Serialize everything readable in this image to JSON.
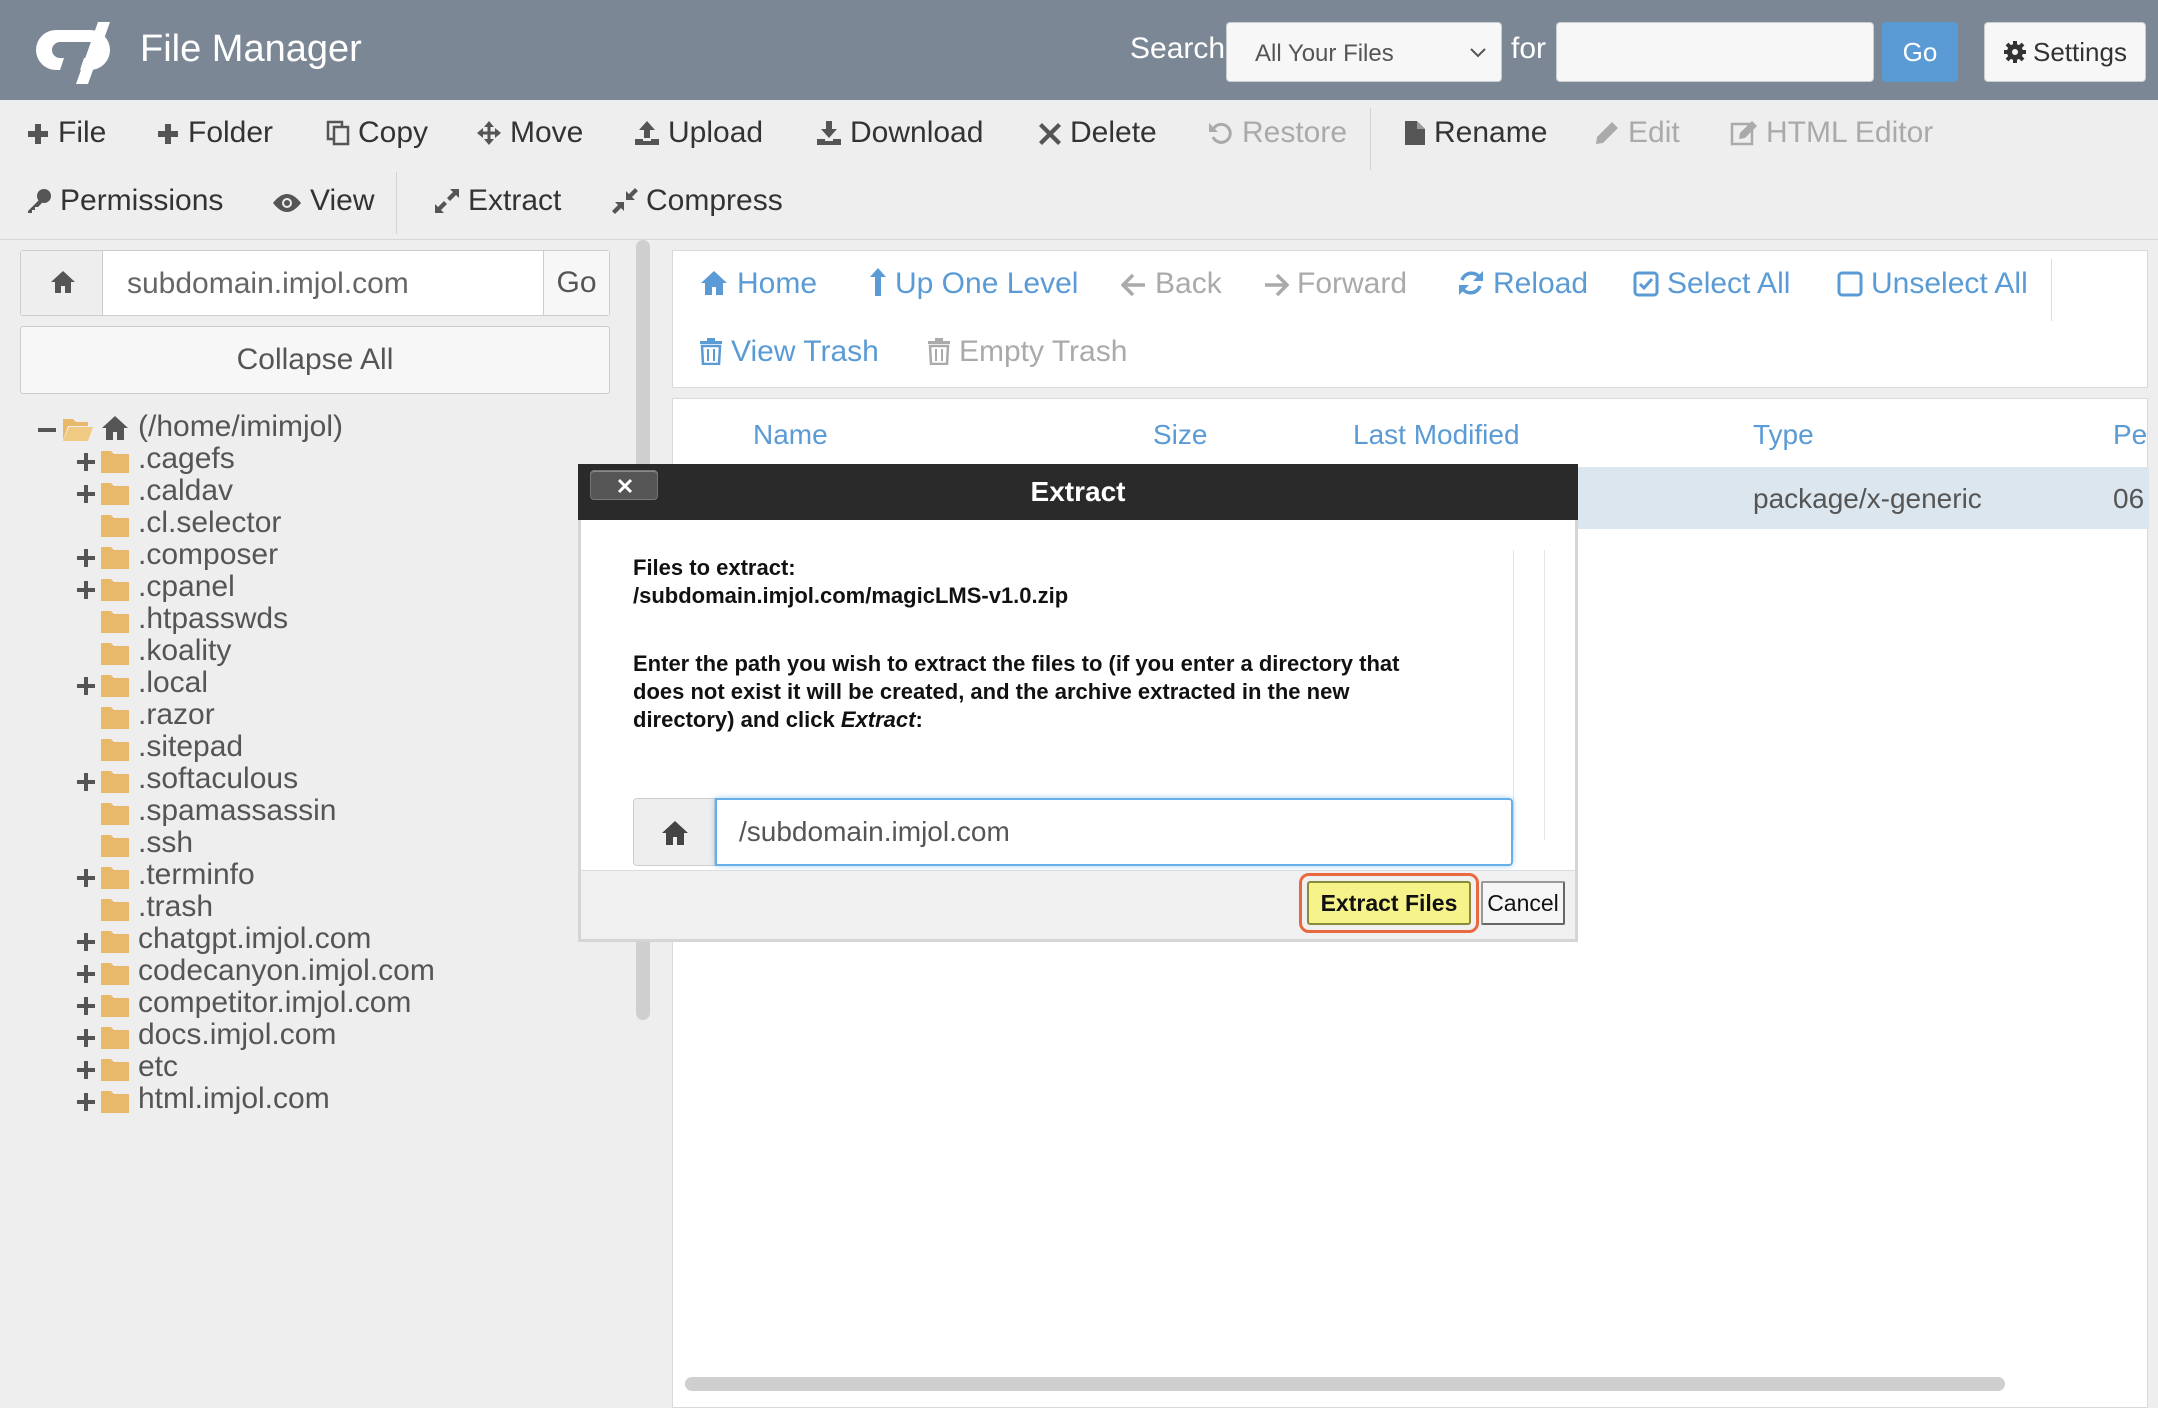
{
  "header": {
    "app_title": "File Manager",
    "search_label": "Search",
    "search_scope": "All Your Files",
    "for_label": "for",
    "search_value": "",
    "go_label": "Go",
    "settings_label": "Settings"
  },
  "toolbar": {
    "row1": [
      "File",
      "Folder",
      "Copy",
      "Move",
      "Upload",
      "Download",
      "Delete",
      "Restore",
      "Rename",
      "Edit",
      "HTML Editor"
    ],
    "row2": [
      "Permissions",
      "View",
      "Extract",
      "Compress"
    ]
  },
  "left": {
    "path_value": "subdomain.imjol.com",
    "go_label": "Go",
    "collapse_label": "Collapse All",
    "root": "(/home/imimjol)",
    "tree": [
      {
        "label": ".cagefs",
        "expandable": true
      },
      {
        "label": ".caldav",
        "expandable": true
      },
      {
        "label": ".cl.selector",
        "expandable": false
      },
      {
        "label": ".composer",
        "expandable": true
      },
      {
        "label": ".cpanel",
        "expandable": true
      },
      {
        "label": ".htpasswds",
        "expandable": false
      },
      {
        "label": ".koality",
        "expandable": false
      },
      {
        "label": ".local",
        "expandable": true
      },
      {
        "label": ".razor",
        "expandable": false
      },
      {
        "label": ".sitepad",
        "expandable": false
      },
      {
        "label": ".softaculous",
        "expandable": true
      },
      {
        "label": ".spamassassin",
        "expandable": false
      },
      {
        "label": ".ssh",
        "expandable": false
      },
      {
        "label": ".terminfo",
        "expandable": true
      },
      {
        "label": ".trash",
        "expandable": false
      },
      {
        "label": "chatgpt.imjol.com",
        "expandable": true
      },
      {
        "label": "codecanyon.imjol.com",
        "expandable": true
      },
      {
        "label": "competitor.imjol.com",
        "expandable": true
      },
      {
        "label": "docs.imjol.com",
        "expandable": true
      },
      {
        "label": "etc",
        "expandable": true
      },
      {
        "label": "html.imjol.com",
        "expandable": true
      }
    ]
  },
  "nav": {
    "home": "Home",
    "up": "Up One Level",
    "back": "Back",
    "forward": "Forward",
    "reload": "Reload",
    "select_all": "Select All",
    "unselect_all": "Unselect All",
    "view_trash": "View Trash",
    "empty_trash": "Empty Trash"
  },
  "table": {
    "headers": {
      "name": "Name",
      "size": "Size",
      "modified": "Last Modified",
      "type": "Type",
      "perms": "Pe"
    },
    "row": {
      "type": "package/x-generic",
      "perms": "06"
    }
  },
  "modal": {
    "title": "Extract",
    "files_label": "Files to extract:",
    "file_path": "/subdomain.imjol.com/magicLMS-v1.0.zip",
    "instructions_1": "Enter the path you wish to extract the files to (if you enter a directory that",
    "instructions_2": "does not exist it will be created, and the archive extracted in the new",
    "instructions_3": "directory) and click",
    "instructions_em": "Extract",
    "instructions_colon": ":",
    "path_value": "/subdomain.imjol.com",
    "extract_button": "Extract Files",
    "cancel_button": "Cancel"
  },
  "colors": {
    "header_bg": "#7b8794",
    "link_blue": "#5b9bd5",
    "folder": "#e8b96a",
    "highlight": "#e8693f",
    "extract_btn": "#f5f38a"
  }
}
